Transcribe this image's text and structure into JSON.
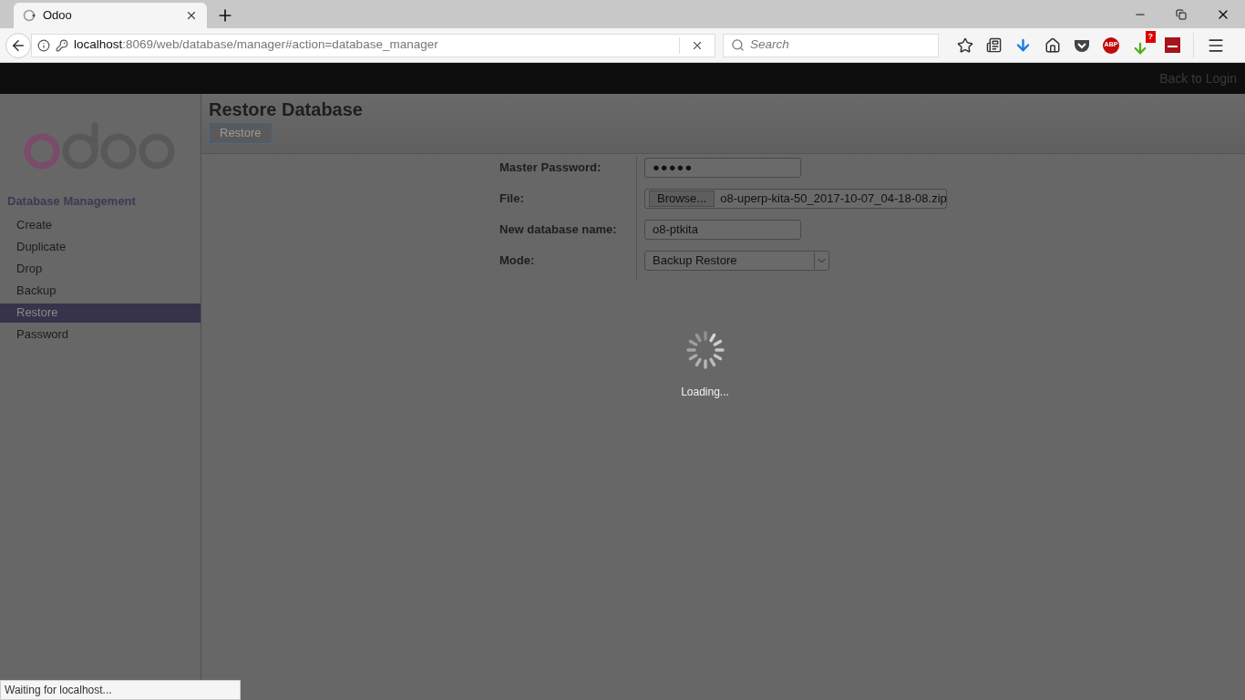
{
  "browser": {
    "tab": {
      "title": "Odoo"
    },
    "url": {
      "host": "localhost",
      "rest": ":8069/web/database/manager#action=database_manager"
    },
    "search": {
      "placeholder": "Search"
    },
    "abp_label": "ABP",
    "download_badge": "?",
    "status": "Waiting for localhost..."
  },
  "topbar": {
    "link": "Back to Login"
  },
  "sidebar": {
    "heading": "Database Management",
    "items": [
      {
        "label": "Create",
        "selected": false
      },
      {
        "label": "Duplicate",
        "selected": false
      },
      {
        "label": "Drop",
        "selected": false
      },
      {
        "label": "Backup",
        "selected": false
      },
      {
        "label": "Restore",
        "selected": true
      },
      {
        "label": "Password",
        "selected": false
      }
    ]
  },
  "page": {
    "title": "Restore Database",
    "button": "Restore"
  },
  "form": [
    {
      "kind": "password",
      "label": "Master Password:",
      "value": "●●●●●"
    },
    {
      "kind": "file",
      "label": "File:",
      "button": "Browse...",
      "value": "o8-uperp-kita-50_2017-10-07_04-18-08.zip"
    },
    {
      "kind": "text",
      "label": "New database name:",
      "value": "o8-ptkita"
    },
    {
      "kind": "select",
      "label": "Mode:",
      "value": "Backup Restore"
    }
  ],
  "loading": {
    "text": "Loading..."
  }
}
